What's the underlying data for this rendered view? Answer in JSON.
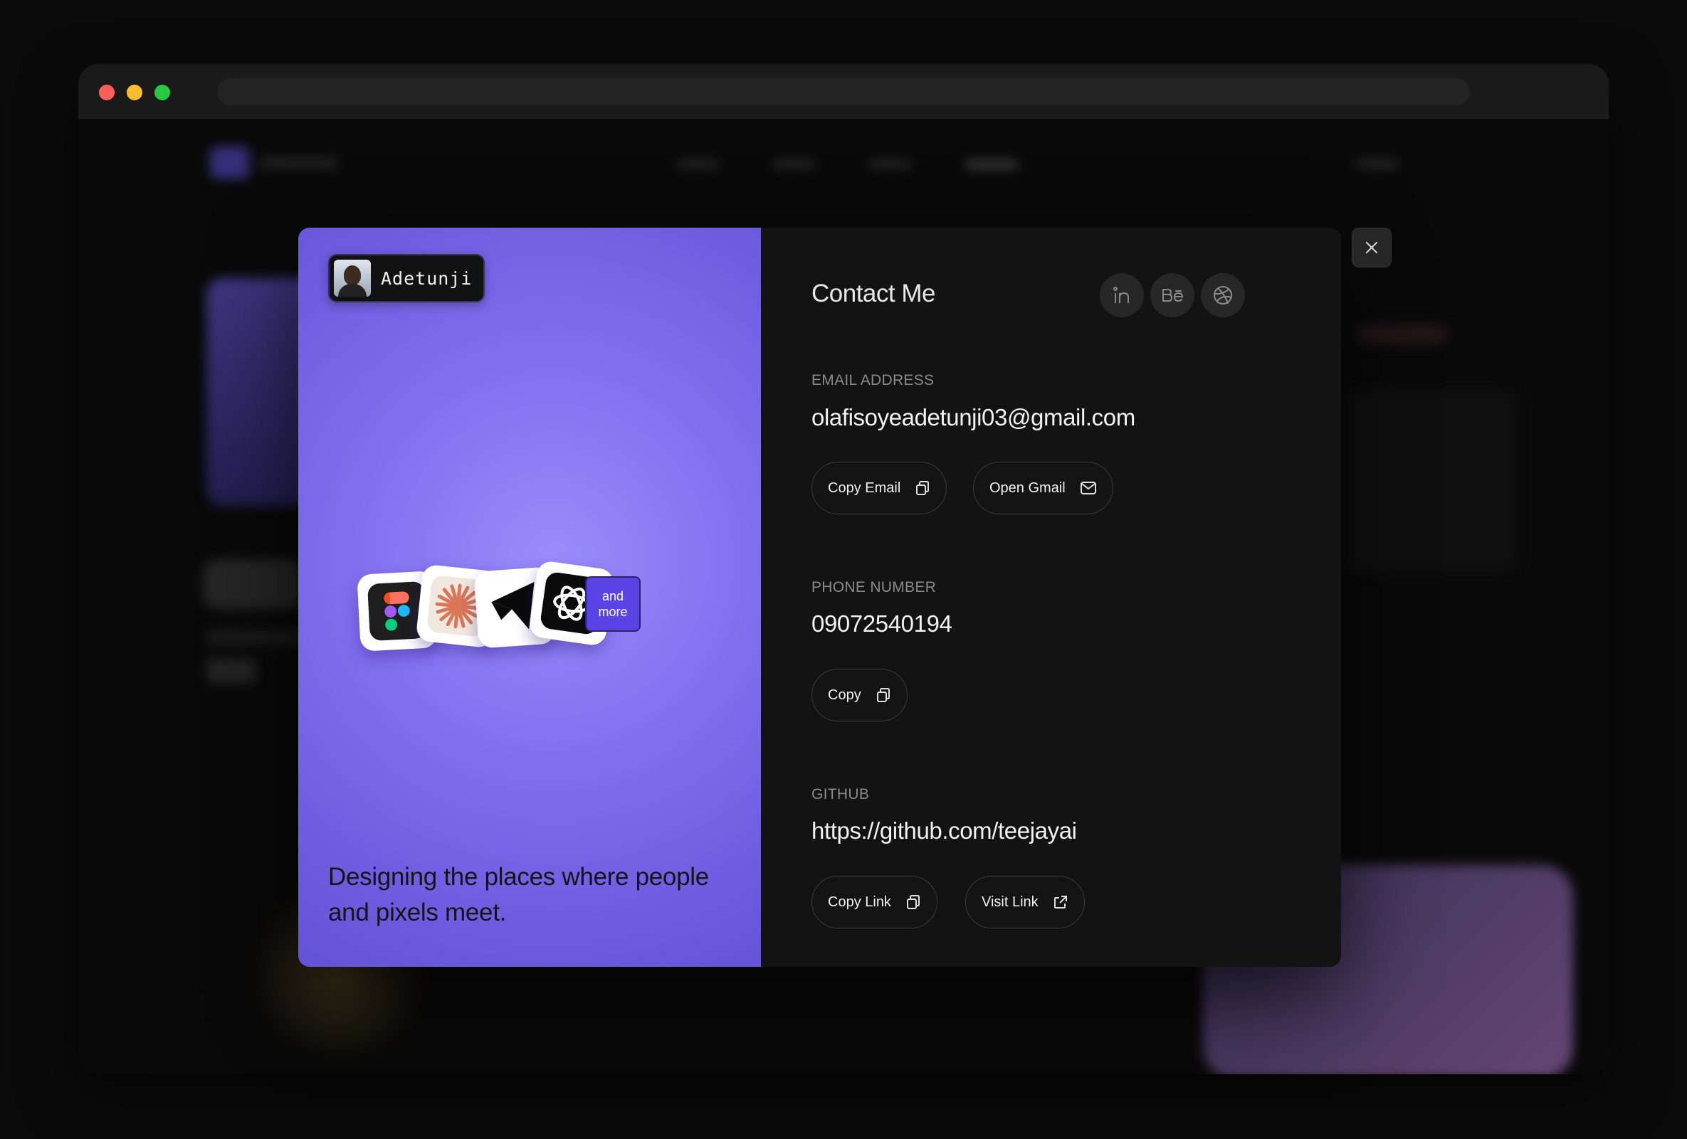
{
  "browser": {
    "url": ""
  },
  "left_panel": {
    "badge_name": "Adetunji",
    "more_line1": "and",
    "more_line2": "more",
    "tagline": "Designing the places where people and pixels meet.",
    "tool_icons": [
      "figma-icon",
      "claude-icon",
      "framer-icon",
      "openai-icon"
    ]
  },
  "right_panel": {
    "title": "Contact Me",
    "socials": [
      "linkedin-icon",
      "behance-icon",
      "dribbble-icon"
    ],
    "email": {
      "label": "EMAIL ADDRESS",
      "value": "olafisoyeadetunji03@gmail.com",
      "copy_label": "Copy Email",
      "open_label": "Open Gmail"
    },
    "phone": {
      "label": "PHONE NUMBER",
      "value": "09072540194",
      "copy_label": "Copy"
    },
    "github": {
      "label": "GITHUB",
      "value": "https://github.com/teejayai",
      "copy_label": "Copy Link",
      "visit_label": "Visit Link"
    }
  },
  "colors": {
    "accent": "#8673f0",
    "panel_bg": "#131313",
    "badge_purple": "#5a44e6"
  }
}
